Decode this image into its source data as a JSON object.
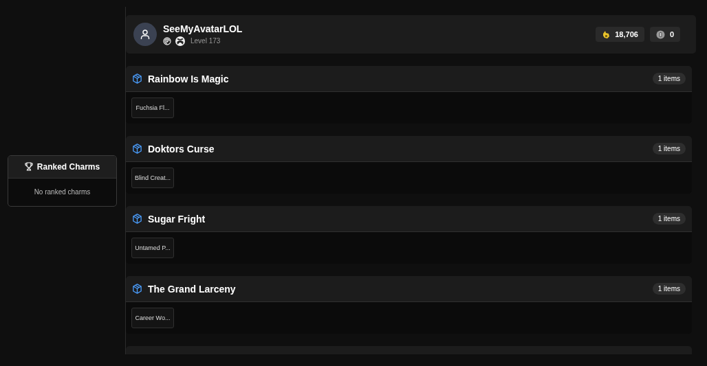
{
  "ranked_charms": {
    "title": "Ranked Charms",
    "empty_text": "No ranked charms"
  },
  "profile": {
    "username": "SeeMyAvatarLOL",
    "level": "Level 173",
    "currencies": [
      {
        "kind": "renown",
        "amount": "18,706"
      },
      {
        "kind": "credits",
        "amount": "0"
      }
    ]
  },
  "collections": [
    {
      "title": "Rainbow Is Magic",
      "count": "1 items",
      "items": [
        "Fuchsia Fl..."
      ]
    },
    {
      "title": "Doktors Curse",
      "count": "1 items",
      "items": [
        "Blind Creat..."
      ]
    },
    {
      "title": "Sugar Fright",
      "count": "1 items",
      "items": [
        "Untamed P..."
      ]
    },
    {
      "title": "The Grand Larceny",
      "count": "1 items",
      "items": [
        "Career Wo..."
      ]
    }
  ]
}
